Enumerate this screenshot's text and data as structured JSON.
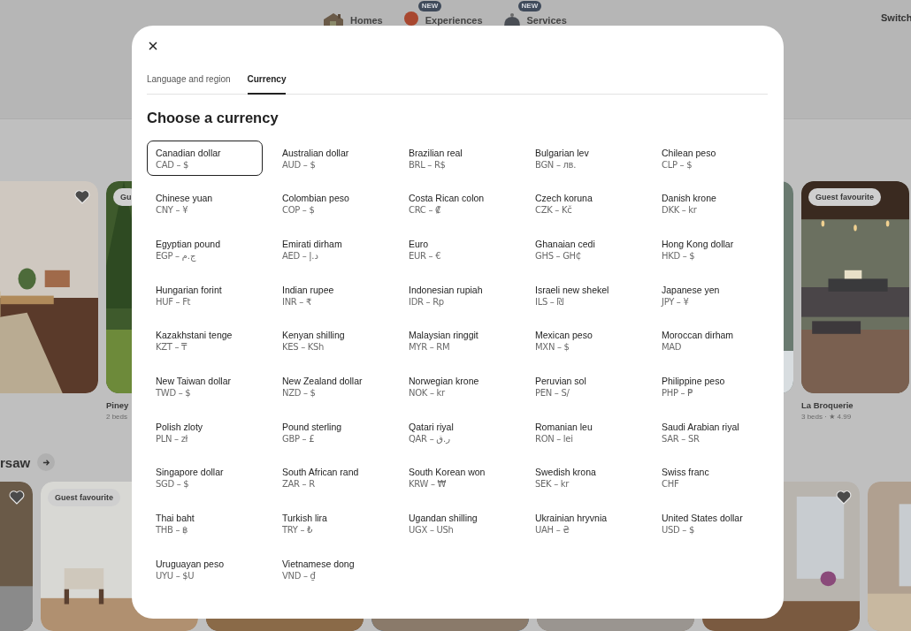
{
  "header": {
    "nav": [
      {
        "kind": "house",
        "label": "Homes"
      },
      {
        "kind": "balloon",
        "label": "Experiences",
        "badge": "NEW"
      },
      {
        "kind": "bell",
        "label": "Services",
        "badge": "NEW"
      }
    ],
    "switch_link": "Switch"
  },
  "row_1": [
    {
      "kind": "picture",
      "heart": true
    },
    {
      "kind": "picture",
      "badge": "Gu",
      "title": "Piney",
      "details": "2 beds"
    },
    {
      "kind": "picture"
    },
    {
      "kind": "picture",
      "badge": "Guest favourite",
      "title": "La Broquerie",
      "details": "3 beds · ★ 4.99"
    }
  ],
  "section_title": "rsaw",
  "row_2": [
    {
      "kind": "picture",
      "heart": true
    },
    {
      "kind": "picture",
      "badge": "Guest favourite"
    },
    {
      "kind": "picture"
    },
    {
      "kind": "picture"
    },
    {
      "kind": "picture"
    },
    {
      "kind": "picture",
      "heart": true
    },
    {
      "kind": "picture"
    }
  ],
  "dialog": {
    "tabs": [
      {
        "label": "Language and region",
        "selected": false
      },
      {
        "label": "Currency",
        "selected": true
      }
    ],
    "title": "Choose a currency",
    "currencies": [
      {
        "name": "Canadian dollar",
        "code": "CAD – $",
        "selected": true
      },
      {
        "name": "Australian dollar",
        "code": "AUD – $",
        "selected": false
      },
      {
        "name": "Brazilian real",
        "code": "BRL – R$",
        "selected": false
      },
      {
        "name": "Bulgarian lev",
        "code": "BGN – лв.",
        "selected": false
      },
      {
        "name": "Chilean peso",
        "code": "CLP – $",
        "selected": false
      },
      {
        "name": "Chinese yuan",
        "code": "CNY – ¥",
        "selected": false
      },
      {
        "name": "Colombian peso",
        "code": "COP – $",
        "selected": false
      },
      {
        "name": "Costa Rican colon",
        "code": "CRC – ₡",
        "selected": false
      },
      {
        "name": "Czech koruna",
        "code": "CZK – Kč",
        "selected": false
      },
      {
        "name": "Danish krone",
        "code": "DKK – kr",
        "selected": false
      },
      {
        "name": "Egyptian pound",
        "code": "EGP – ج.م",
        "selected": false
      },
      {
        "name": "Emirati dirham",
        "code": "AED – د.إ",
        "selected": false
      },
      {
        "name": "Euro",
        "code": "EUR – €",
        "selected": false
      },
      {
        "name": "Ghanaian cedi",
        "code": "GHS – GH₵",
        "selected": false
      },
      {
        "name": "Hong Kong dollar",
        "code": "HKD – $",
        "selected": false
      },
      {
        "name": "Hungarian forint",
        "code": "HUF – Ft",
        "selected": false
      },
      {
        "name": "Indian rupee",
        "code": "INR – ₹",
        "selected": false
      },
      {
        "name": "Indonesian rupiah",
        "code": "IDR – Rp",
        "selected": false
      },
      {
        "name": "Israeli new shekel",
        "code": "ILS – ₪",
        "selected": false
      },
      {
        "name": "Japanese yen",
        "code": "JPY – ¥",
        "selected": false
      },
      {
        "name": "Kazakhstani tenge",
        "code": "KZT – ₸",
        "selected": false
      },
      {
        "name": "Kenyan shilling",
        "code": "KES – KSh",
        "selected": false
      },
      {
        "name": "Malaysian ringgit",
        "code": "MYR – RM",
        "selected": false
      },
      {
        "name": "Mexican peso",
        "code": "MXN – $",
        "selected": false
      },
      {
        "name": "Moroccan dirham",
        "code": "MAD",
        "selected": false
      },
      {
        "name": "New Taiwan dollar",
        "code": "TWD – $",
        "selected": false
      },
      {
        "name": "New Zealand dollar",
        "code": "NZD – $",
        "selected": false
      },
      {
        "name": "Norwegian krone",
        "code": "NOK – kr",
        "selected": false
      },
      {
        "name": "Peruvian sol",
        "code": "PEN – S/",
        "selected": false
      },
      {
        "name": "Philippine peso",
        "code": "PHP – ₱",
        "selected": false
      },
      {
        "name": "Polish zloty",
        "code": "PLN – zł",
        "selected": false
      },
      {
        "name": "Pound sterling",
        "code": "GBP – £",
        "selected": false
      },
      {
        "name": "Qatari riyal",
        "code": "QAR – ر.ق",
        "selected": false
      },
      {
        "name": "Romanian leu",
        "code": "RON – lei",
        "selected": false
      },
      {
        "name": "Saudi Arabian riyal",
        "code": "SAR – SR",
        "selected": false
      },
      {
        "name": "Singapore dollar",
        "code": "SGD – $",
        "selected": false
      },
      {
        "name": "South African rand",
        "code": "ZAR – R",
        "selected": false
      },
      {
        "name": "South Korean won",
        "code": "KRW – ₩",
        "selected": false
      },
      {
        "name": "Swedish krona",
        "code": "SEK – kr",
        "selected": false
      },
      {
        "name": "Swiss franc",
        "code": "CHF",
        "selected": false
      },
      {
        "name": "Thai baht",
        "code": "THB – ฿",
        "selected": false
      },
      {
        "name": "Turkish lira",
        "code": "TRY – ₺",
        "selected": false
      },
      {
        "name": "Ugandan shilling",
        "code": "UGX – USh",
        "selected": false
      },
      {
        "name": "Ukrainian hryvnia",
        "code": "UAH – ₴",
        "selected": false
      },
      {
        "name": "United States dollar",
        "code": "USD – $",
        "selected": false
      },
      {
        "name": "Uruguayan peso",
        "code": "UYU – $U",
        "selected": false
      },
      {
        "name": "Vietnamese dong",
        "code": "VND – ₫",
        "selected": false
      }
    ]
  }
}
